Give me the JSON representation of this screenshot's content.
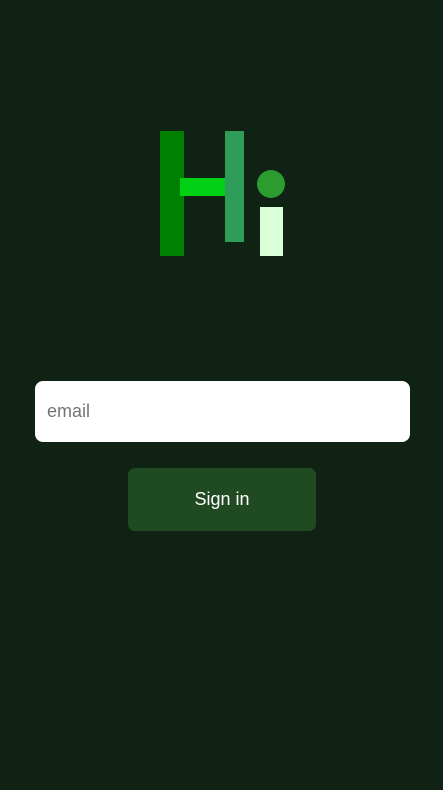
{
  "theme": {
    "background": "#0f2214",
    "button_background": "#1f4a22",
    "input_background": "#ffffff"
  },
  "logo": {
    "h_left_color": "#008000",
    "h_cross_color": "#00d115",
    "h_right_color": "#2e9d5a",
    "i_dot_color": "#2b9c30",
    "i_stem_color": "#d9ffd9"
  },
  "form": {
    "email_placeholder": "email",
    "email_value": "",
    "signin_label": "Sign in"
  }
}
